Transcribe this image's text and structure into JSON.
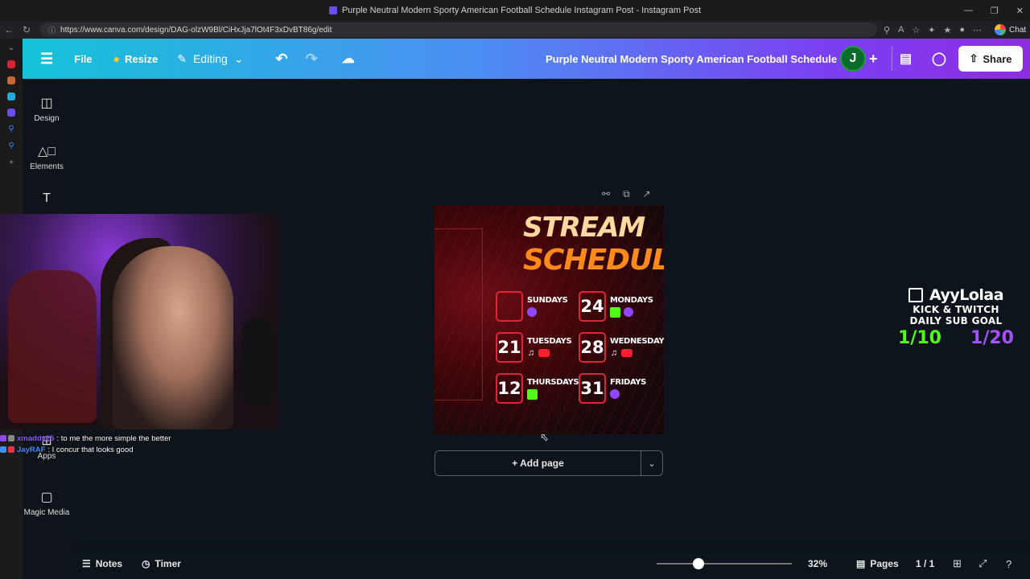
{
  "browser": {
    "window_title": "Purple Neutral Modern Sporty American Football Schedule Instagram Post - Instagram Post",
    "url": "https://www.canva.com/design/DAG-olzW9Bl/CiHxJja7lOt4F3xDvBT86g/edit",
    "chat_label": "Chat"
  },
  "topbar": {
    "file_label": "File",
    "resize_label": "Resize",
    "editing_label": "Editing",
    "doc_title": "Purple Neutral Modern Sporty American Football Schedule ...",
    "avatar_initial": "J",
    "share_label": "Share"
  },
  "sidebar": {
    "items": [
      {
        "label": "Design",
        "icon": "design-icon"
      },
      {
        "label": "Elements",
        "icon": "elements-icon"
      },
      {
        "label": "Apps",
        "icon": "apps-icon"
      },
      {
        "label": "Magic Media",
        "icon": "magic-media-icon"
      }
    ]
  },
  "design": {
    "title_line1": "STREAM",
    "title_line2": "SCHEDULE",
    "days": [
      {
        "date": "",
        "name": "SUNDAYS",
        "platforms": [
          "twitch"
        ]
      },
      {
        "date": "24",
        "name": "MONDAYS",
        "platforms": [
          "kick",
          "twitch"
        ]
      },
      {
        "date": "21",
        "name": "TUESDAYS",
        "platforms": [
          "tiktok",
          "youtube"
        ]
      },
      {
        "date": "28",
        "name": "WEDNESDAYS",
        "platforms": [
          "tiktok",
          "youtube"
        ]
      },
      {
        "date": "12",
        "name": "THURSDAYS",
        "platforms": [
          "kick"
        ]
      },
      {
        "date": "31",
        "name": "FRIDAYS",
        "platforms": [
          "twitch"
        ]
      }
    ]
  },
  "canvas": {
    "add_page_label": "+ Add page"
  },
  "bottombar": {
    "notes_label": "Notes",
    "timer_label": "Timer",
    "zoom_label": "32%",
    "zoom_fraction": 0.31,
    "pages_label": "Pages",
    "page_count": "1 / 1"
  },
  "chat": {
    "messages": [
      {
        "user": "xmaddy25",
        "text": ": to me the more simple the better"
      },
      {
        "user": "JayRAF",
        "text": ": I concur that looks good"
      }
    ]
  },
  "subgoal": {
    "channel": "AyyLolaa",
    "line1": "KICK & TWITCH",
    "line2": "DAILY SUB GOAL",
    "kick_count": "1/10",
    "twitch_count": "1/20"
  },
  "colors": {
    "kick": "#53fc18",
    "twitch": "#9146ff",
    "youtube": "#ff1f2f",
    "accent_red": "#e0243a",
    "title_orange": "#ff8a1c"
  }
}
